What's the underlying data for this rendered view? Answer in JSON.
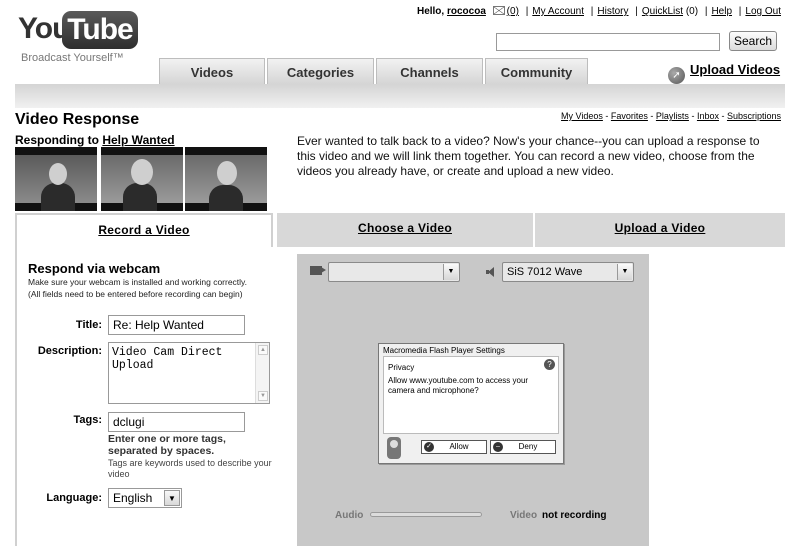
{
  "header": {
    "logo": {
      "you": "You",
      "tube": "Tube",
      "tagline": "Broadcast Yourself™"
    },
    "greeting": "Hello,",
    "username": "rococoa",
    "inbox_count": "(0)",
    "links": [
      "My Account",
      "History",
      "QuickList",
      "Help",
      "Log Out"
    ],
    "quicklist_count": "(0)",
    "search": {
      "value": "",
      "button": "Search"
    },
    "tabs": [
      "Videos",
      "Categories",
      "Channels",
      "Community"
    ],
    "upload_link": "Upload Videos"
  },
  "page": {
    "title": "Video Response",
    "sublinks": [
      "My Videos",
      "Favorites",
      "Playlists",
      "Inbox",
      "Subscriptions"
    ],
    "responding_prefix": "Responding to",
    "responding_video": "Help Wanted",
    "intro": "Ever wanted to talk back to a video? Now's your chance--you can upload a response to this video and we will link them together. You can record a new video, choose from the videos you already have, or create and upload a new video."
  },
  "mode_tabs": [
    "Record a Video",
    "Choose a Video",
    "Upload a Video"
  ],
  "form": {
    "heading": "Respond via webcam",
    "note1": "Make sure your webcam is installed and working correctly.",
    "note2": "(All fields need to be entered before recording can begin)",
    "title_label": "Title:",
    "title_value": "Re: Help Wanted",
    "description_label": "Description:",
    "description_value": "Video Cam Direct\nUpload",
    "tags_label": "Tags:",
    "tags_value": "dclugi",
    "tags_help_bold": "Enter one or more tags, separated by spaces.",
    "tags_help": "Tags are keywords used to describe your video",
    "language_label": "Language:",
    "language_value": "English"
  },
  "recorder": {
    "camera_value": "",
    "mic_value": "SiS 7012 Wave",
    "flash": {
      "title": "Macromedia Flash Player Settings",
      "section": "Privacy",
      "message": "Allow www.youtube.com to access your camera and microphone?",
      "allow": "Allow",
      "deny": "Deny"
    },
    "audio_label": "Audio",
    "video_label": "Video",
    "status": "not recording"
  },
  "colors": {
    "panel": "#c8c8c8",
    "tab_inactive": "#d8d8d8",
    "nav_band": "#d4d4d4"
  }
}
